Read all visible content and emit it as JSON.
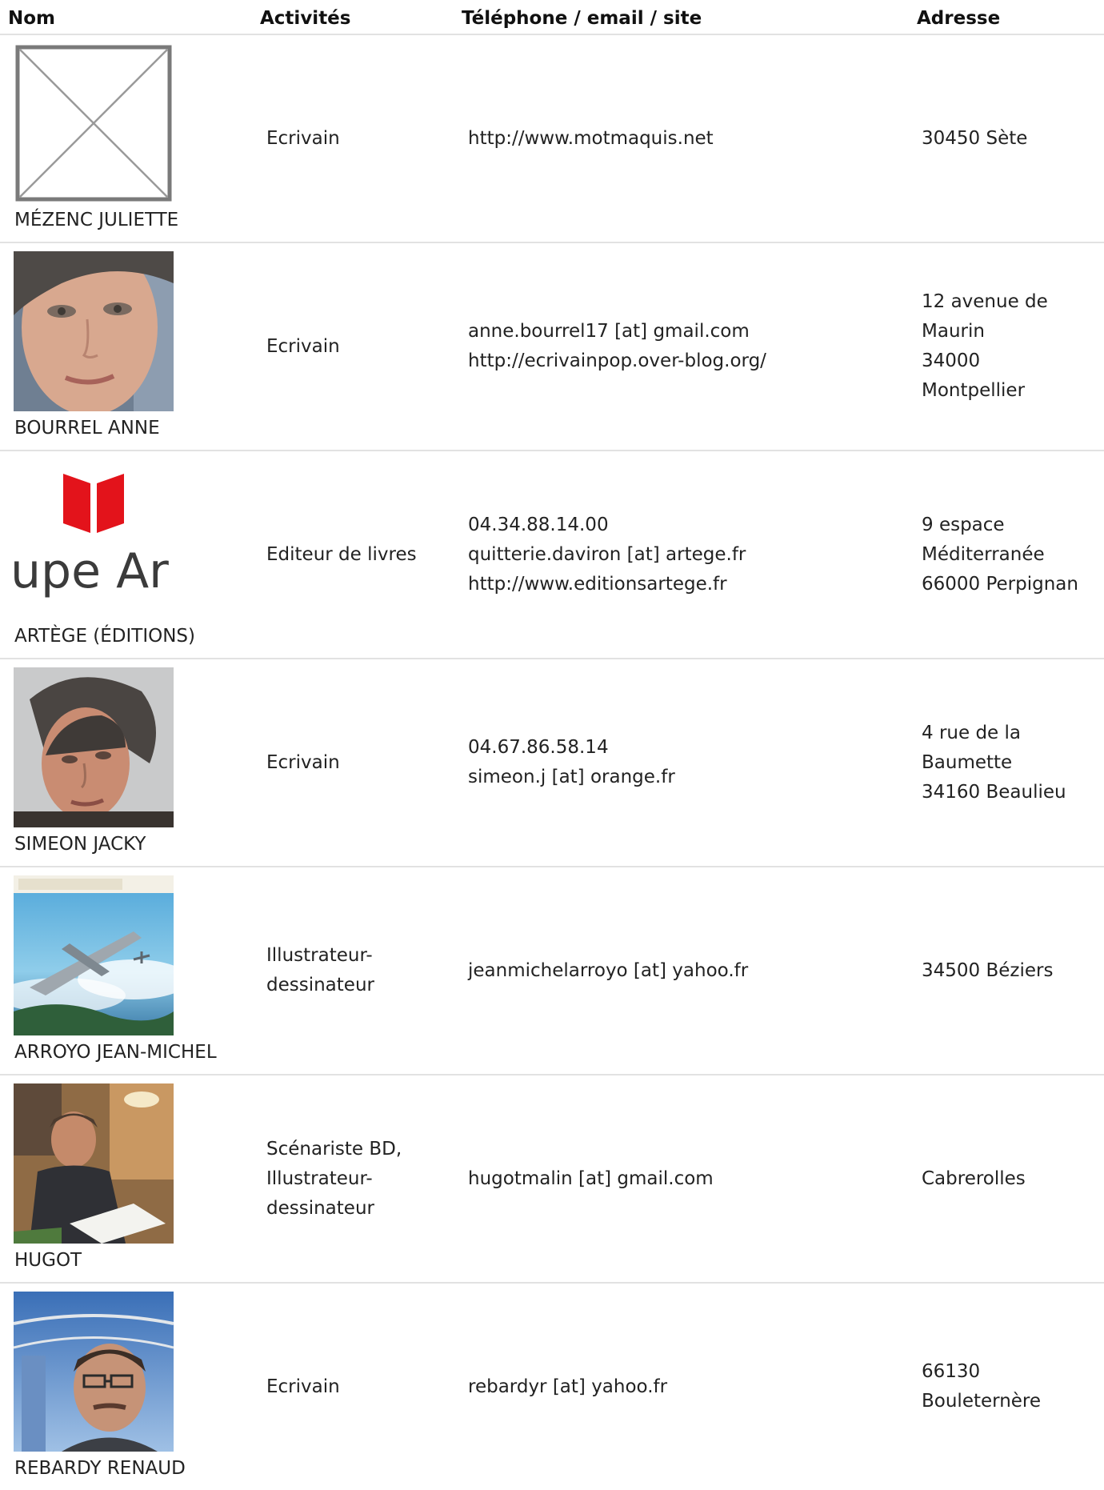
{
  "headers": {
    "nom": "Nom",
    "activites": "Activités",
    "contact": "Téléphone / email / site",
    "adresse": "Adresse"
  },
  "rows": [
    {
      "name": "MÉZENC JULIETTE",
      "activity": "Ecrivain",
      "contact": "http://www.motmaquis.net",
      "address": "30450 Sète",
      "photo": "placeholder-image"
    },
    {
      "name": "BOURREL ANNE",
      "activity": "Ecrivain",
      "contact": "anne.bourrel17 [at] gmail.com\nhttp://ecrivainpop.over-blog.org/",
      "address": "12 avenue de\nMaurin\n34000\nMontpellier",
      "photo": "portrait-woman"
    },
    {
      "name": "ARTÈGE (ÉDITIONS)",
      "activity": "Editeur de livres",
      "contact": "04.34.88.14.00\nquitterie.daviron [at] artege.fr\nhttp://www.editionsartege.fr",
      "address": "9 espace\nMéditerranée\n66000 Perpignan",
      "photo": "publisher-logo",
      "photo_text": "upe Ar"
    },
    {
      "name": "SIMEON JACKY",
      "activity": "Ecrivain",
      "contact": "04.67.86.58.14\nsimeon.j [at] orange.fr",
      "address": "4 rue de la\nBaumette\n34160 Beaulieu",
      "photo": "portrait-man-gray-hair"
    },
    {
      "name": "ARROYO JEAN-MICHEL",
      "activity": "Illustrateur-\ndessinateur",
      "contact": "jeanmichelarroyo [at] yahoo.fr",
      "address": "34500 Béziers",
      "photo": "comic-cover-airplanes"
    },
    {
      "name": "HUGOT",
      "activity": "Scénariste BD,\nIllustrateur-\ndessinateur",
      "contact": "hugotmalin [at] gmail.com",
      "address": "Cabrerolles",
      "photo": "man-at-drawing-desk"
    },
    {
      "name": "REBARDY RENAUD",
      "activity": "Ecrivain",
      "contact": "rebardyr [at] yahoo.fr",
      "address": "66130\nBouleternère",
      "photo": "portrait-man-glasses"
    }
  ]
}
